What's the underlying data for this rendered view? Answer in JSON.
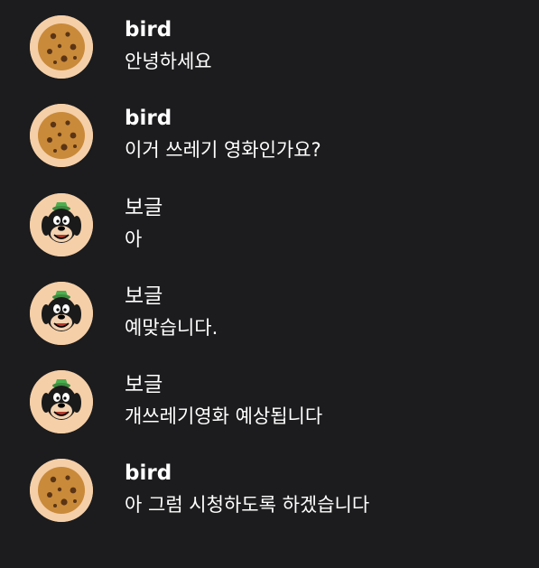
{
  "messages": [
    {
      "avatar": "cookie-avatar-icon",
      "author": "bird",
      "text": "안녕하세요"
    },
    {
      "avatar": "cookie-avatar-icon",
      "author": "bird",
      "text": "이거 쓰레기 영화인가요?"
    },
    {
      "avatar": "goofy-avatar-icon",
      "author": "보글",
      "text": "아"
    },
    {
      "avatar": "goofy-avatar-icon",
      "author": "보글",
      "text": "예맞습니다."
    },
    {
      "avatar": "goofy-avatar-icon",
      "author": "보글",
      "text": "개쓰레기영화 예상됩니다"
    },
    {
      "avatar": "cookie-avatar-icon",
      "author": "bird",
      "text": "아 그럼 시청하도록 하겠습니다"
    }
  ],
  "colors": {
    "background": "#1c1c1e",
    "text": "#ffffff",
    "avatar_bg": "#f5cfa8",
    "cookie": "#c98a3a",
    "cookie_chips": "#5a3414"
  }
}
